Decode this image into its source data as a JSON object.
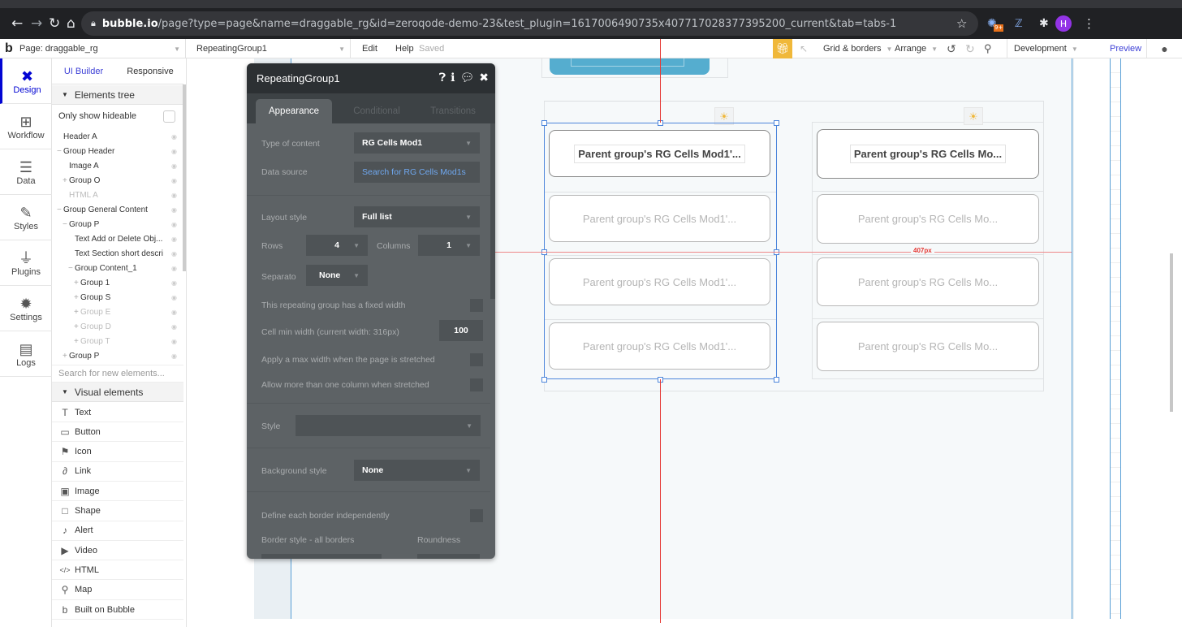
{
  "browser": {
    "url_host": "bubble.io",
    "url_path": "/page?type=page&name=draggable_rg&id=zeroqode-demo-23&test_plugin=1617006490735x407717028377395200_current&tab=tabs-1",
    "extension_badge": "9+",
    "profile_initial": "H"
  },
  "topbar": {
    "page_selector": "Page: draggable_rg",
    "element_selector": "RepeatingGroup1",
    "edit": "Edit",
    "help": "Help",
    "saved": "Saved",
    "grid_borders": "Grid & borders",
    "arrange": "Arrange",
    "environment": "Development",
    "preview": "Preview"
  },
  "rail": {
    "items": [
      {
        "label": "Design",
        "icon": "design-icon",
        "glyph": "✖",
        "active": true
      },
      {
        "label": "Workflow",
        "icon": "workflow-icon",
        "glyph": "⊞"
      },
      {
        "label": "Data",
        "icon": "database-icon",
        "glyph": "☰"
      },
      {
        "label": "Styles",
        "icon": "brush-icon",
        "glyph": "✎"
      },
      {
        "label": "Plugins",
        "icon": "plug-icon",
        "glyph": "⏚"
      },
      {
        "label": "Settings",
        "icon": "gear-icon",
        "glyph": "✹"
      },
      {
        "label": "Logs",
        "icon": "document-icon",
        "glyph": "▤"
      }
    ]
  },
  "panel": {
    "tabs": [
      "UI Builder",
      "Responsive"
    ],
    "elements_tree_header": "Elements tree",
    "only_show_hideable": "Only show hideable",
    "tree": [
      {
        "label": "Header A",
        "indent": 0,
        "prefix": "",
        "dim": false
      },
      {
        "label": "Group Header",
        "indent": 0,
        "prefix": "−",
        "dim": false
      },
      {
        "label": "Image A",
        "indent": 1,
        "prefix": "",
        "dim": false
      },
      {
        "label": "Group O",
        "indent": 1,
        "prefix": "+",
        "dim": false
      },
      {
        "label": "HTML A",
        "indent": 1,
        "prefix": "",
        "dim": true
      },
      {
        "label": "Group General Content",
        "indent": 0,
        "prefix": "−",
        "dim": false
      },
      {
        "label": "Group P",
        "indent": 1,
        "prefix": "−",
        "dim": false
      },
      {
        "label": "Text Add or Delete Obj...",
        "indent": 2,
        "prefix": "",
        "dim": false
      },
      {
        "label": "Text Section short descri",
        "indent": 2,
        "prefix": "",
        "dim": false
      },
      {
        "label": "Group Content_1",
        "indent": 2,
        "prefix": "−",
        "dim": false
      },
      {
        "label": "Group 1",
        "indent": 3,
        "prefix": "+",
        "dim": false
      },
      {
        "label": "Group S",
        "indent": 3,
        "prefix": "+",
        "dim": false
      },
      {
        "label": "Group E",
        "indent": 3,
        "prefix": "+",
        "dim": true
      },
      {
        "label": "Group D",
        "indent": 3,
        "prefix": "+",
        "dim": true
      },
      {
        "label": "Group T",
        "indent": 3,
        "prefix": "+",
        "dim": true
      },
      {
        "label": "Group P",
        "indent": 1,
        "prefix": "+",
        "dim": false
      }
    ],
    "search_placeholder": "Search for new elements...",
    "visual_elements_header": "Visual elements",
    "visual_elements": [
      {
        "label": "Text",
        "icon": "text-icon",
        "glyph": "T"
      },
      {
        "label": "Button",
        "icon": "button-icon",
        "glyph": "▭"
      },
      {
        "label": "Icon",
        "icon": "flag-icon",
        "glyph": "⚑"
      },
      {
        "label": "Link",
        "icon": "link-icon",
        "glyph": "∂"
      },
      {
        "label": "Image",
        "icon": "image-icon",
        "glyph": "▣"
      },
      {
        "label": "Shape",
        "icon": "shape-icon",
        "glyph": "□"
      },
      {
        "label": "Alert",
        "icon": "bell-icon",
        "glyph": "♪"
      },
      {
        "label": "Video",
        "icon": "video-icon",
        "glyph": "▶"
      },
      {
        "label": "HTML",
        "icon": "code-icon",
        "glyph": "</>"
      },
      {
        "label": "Map",
        "icon": "map-pin-icon",
        "glyph": "⚲"
      },
      {
        "label": "Built on Bubble",
        "icon": "bubble-logo-icon",
        "glyph": "b"
      }
    ]
  },
  "property_editor": {
    "title": "RepeatingGroup1",
    "tabs": [
      "Appearance",
      "Conditional",
      "Transitions"
    ],
    "type_of_content_label": "Type of content",
    "type_of_content": "RG Cells Mod1",
    "data_source_label": "Data source",
    "data_source": "Search for RG Cells Mod1s",
    "layout_style_label": "Layout style",
    "layout_style": "Full list",
    "rows_label": "Rows",
    "rows": "4",
    "columns_label": "Columns",
    "columns": "1",
    "separator_label": "Separato",
    "separator": "None",
    "fixed_width_label": "This repeating group has a fixed width",
    "cell_min_width_label": "Cell min width (current width: 316px)",
    "cell_min_width": "100",
    "max_width_label": "Apply a max width when the page is stretched",
    "more_columns_label": "Allow more than one column when stretched",
    "style_label": "Style",
    "style": "",
    "background_style_label": "Background style",
    "background_style": "None",
    "border_independent_label": "Define each border independently",
    "border_style_label": "Border style - all borders",
    "roundness_label": "Roundness"
  },
  "canvas": {
    "distance_label": "407px",
    "rg_left_cells": [
      "Parent group's RG Cells Mod1'...",
      "Parent group's RG Cells Mod1'...",
      "Parent group's RG Cells Mod1'...",
      "Parent group's RG Cells Mod1'..."
    ],
    "rg_right_cells": [
      "Parent group's RG Cells Mo...",
      "Parent group's RG Cells Mo...",
      "Parent group's RG Cells Mo...",
      "Parent group's RG Cells Mo..."
    ]
  },
  "colors": {
    "accent": "#0205d3",
    "selection": "#4d86db",
    "guide": "#e53935",
    "gift": "#f0b83a",
    "header_blue": "#55adcf"
  }
}
